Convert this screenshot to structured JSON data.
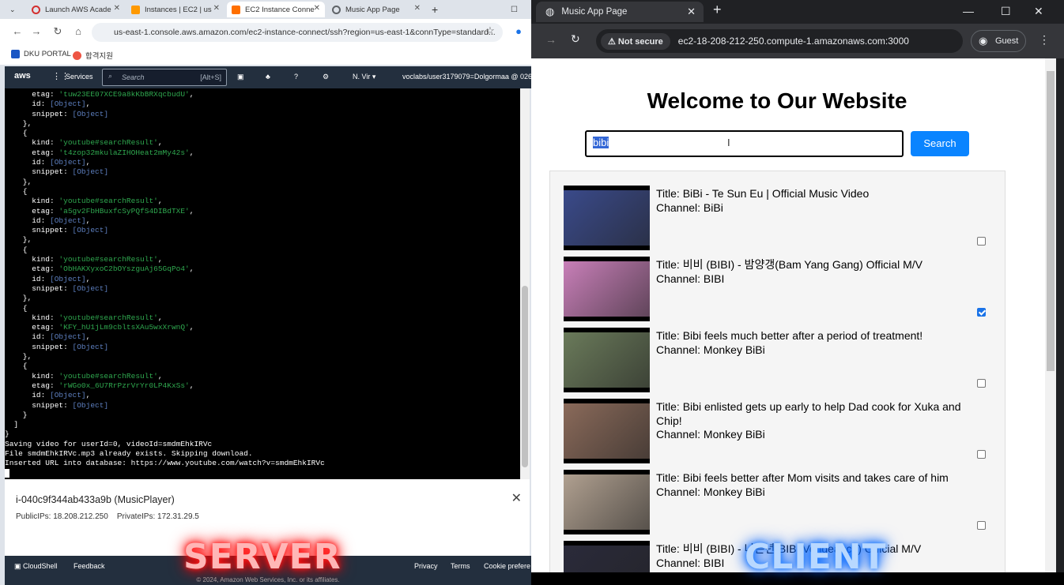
{
  "left_browser": {
    "tabs": [
      {
        "title": "Launch AWS Acade",
        "color": "#d32f2f"
      },
      {
        "title": "Instances | EC2 | us",
        "color": "#ff9900"
      },
      {
        "title": "EC2 Instance Conne",
        "color": "#ff6f00"
      },
      {
        "title": "Music App Page",
        "color": "#5f6368"
      }
    ],
    "url": "us-east-1.console.aws.amazon.com/ec2-instance-connect/ssh?region=us-east-1&connType=standard...",
    "bookmarks": [
      "DKU PORTAL",
      "합격지원"
    ]
  },
  "aws_nav": {
    "logo": "aws",
    "services": "Services",
    "search_placeholder": "Search",
    "search_shortcut": "[Alt+S]",
    "region": "N. Vir",
    "account": "voclabs/user3179079=Dolgormaa @ 026"
  },
  "terminal": {
    "entries": [
      {
        "kind": "'youtube#searchResult'",
        "etag": "'t4zop32mkulaZIHOHeat2mMy42s'"
      },
      {
        "kind": "'youtube#searchResult'",
        "etag": "'a5gv2FbHBuxfcSyPQfS4DIBdTXE'"
      },
      {
        "kind": "'youtube#searchResult'",
        "etag": "'ObHAKXyxoC2bOYszguAj65GqPo4'"
      },
      {
        "kind": "'youtube#searchResult'",
        "etag": "'KFY_hU1jLm9cbltsXAu5wxXrwnQ'"
      },
      {
        "kind": "'youtube#searchResult'",
        "etag": "'rWGo0x_6U7RrPzrVrYr0LP4KxSs'"
      }
    ],
    "first_etag": "'tuw23EE07XCE9a8kKbBRXqcbudU'",
    "obj": "[Object]",
    "log": [
      "Saving video for userId=0, videoId=smdmEhkIRVc",
      "File smdmEhkIRVc.mp3 already exists. Skipping download.",
      "Inserted URL into database: https://www.youtube.com/watch?v=smdmEhkIRVc"
    ]
  },
  "instance": {
    "title": "i-040c9f344ab433a9b (MusicPlayer)",
    "public_ips": "PublicIPs: 18.208.212.250",
    "private_ips": "PrivateIPs: 172.31.29.5"
  },
  "footer": {
    "cloudshell": "CloudShell",
    "feedback": "Feedback",
    "privacy": "Privacy",
    "terms": "Terms",
    "cookie": "Cookie prefere",
    "copyright": "© 2024, Amazon Web Services, Inc. or its affiliates."
  },
  "overlay": {
    "server": "SERVER",
    "client": "CLIENT"
  },
  "right_browser": {
    "tab_title": "Music App Page",
    "not_secure": "Not secure",
    "url": "ec2-18-208-212-250.compute-1.amazonaws.com:3000",
    "guest": "Guest"
  },
  "app": {
    "heading": "Welcome to Our Website",
    "search_value": "bibi",
    "search_button": "Search",
    "results": [
      {
        "title": "Title: BiBi - Te Sun Eu | Official Music Video",
        "channel": "Channel: BiBi",
        "checked": false,
        "thumb": "#3a4a8a"
      },
      {
        "title": "Title: 비비 (BIBI) - 밤양갱(Bam Yang Gang) Official M/V",
        "channel": "Channel: BIBI",
        "checked": true,
        "thumb": "#c87fb8"
      },
      {
        "title": "Title: Bibi feels much better after a period of treatment!",
        "channel": "Channel: Monkey BiBi",
        "checked": false,
        "thumb": "#6a7a5a"
      },
      {
        "title": "Title: Bibi enlisted gets up early to help Dad cook for Xuka and Chip!",
        "channel": "Channel: Monkey BiBi",
        "checked": false,
        "thumb": "#8a6a5a"
      },
      {
        "title": "Title: Bibi feels better after Mom visits and takes care of him",
        "channel": "Channel: Monkey BiBi",
        "checked": false,
        "thumb": "#b0a090"
      },
      {
        "title": "Title: 비비 (BIBI) - 나쁜년(BIBI Vengeance) Official M/V",
        "channel": "Channel: BIBI",
        "checked": false,
        "thumb": "#2a2a3a"
      }
    ]
  }
}
